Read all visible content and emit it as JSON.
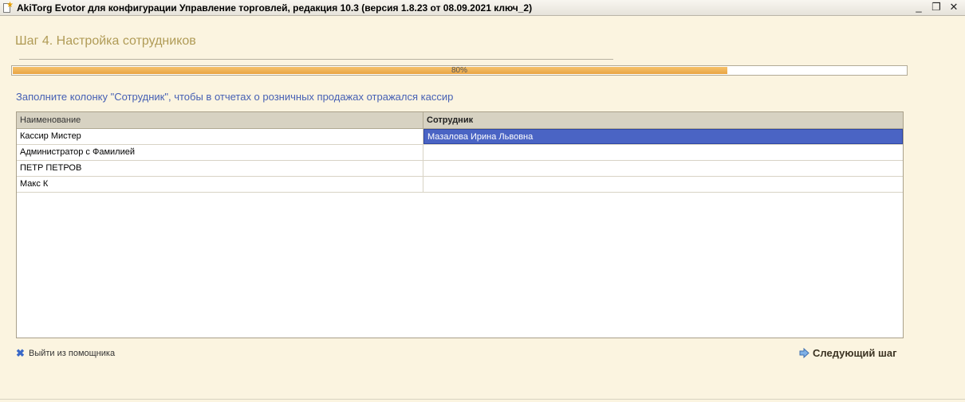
{
  "window": {
    "title": "AkiTorg Evotor для конфигурации Управление торговлей, редакция 10.3 (версия 1.8.23 от 08.09.2021 ключ_2)",
    "controls": [
      "minimize",
      "restore",
      "close"
    ]
  },
  "wizard": {
    "step_title": "Шаг 4. Настройка сотрудников",
    "progress": {
      "label": "80%",
      "value": 0.8
    },
    "hint": "Заполните колонку \"Сотрудник\", чтобы в отчетах о розничных продажах отражался кассир"
  },
  "table": {
    "columns": [
      "Наименование",
      "Сотрудник"
    ],
    "rows": [
      {
        "name": "Кассир Мистер",
        "employee": "Мазалова Ирина Львовна",
        "selected": true
      },
      {
        "name": "Администратор с Фамилией",
        "employee": ""
      },
      {
        "name": "ПЕТР ПЕТРОВ",
        "employee": ""
      },
      {
        "name": "Макс К",
        "employee": ""
      }
    ]
  },
  "footer": {
    "exit_label": "Выйти из помощника",
    "next_label": "Следующий шаг"
  },
  "colors": {
    "background": "#fbf4e0",
    "title": "#b09b56",
    "hint": "#4660b4",
    "progress": "#eea84a",
    "selection": "#4a64c4"
  },
  "icons": {
    "app": "app-document-icon",
    "exit": "cross-icon",
    "next": "arrow-right-icon"
  }
}
